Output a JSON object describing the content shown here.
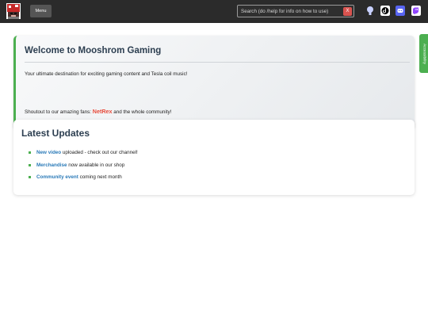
{
  "header": {
    "menu_label": "Menu",
    "search": {
      "placeholder": "Search (do /help for info on how to use)",
      "clear_label": "X"
    },
    "social_icons": [
      "github-icon",
      "tiktok-icon",
      "discord-icon",
      "twitch-icon"
    ]
  },
  "accessibility_tab": "Accessibility",
  "welcome": {
    "title": "Welcome to Mooshrom Gaming",
    "intro": "Your ultimate destination for exciting gaming content and Tesla coil music!",
    "shoutout_before": "Shoutout to our amazing fans: ",
    "shoutout_name": "NetRex",
    "shoutout_after": " and the whole community!"
  },
  "updates": {
    "title": "Latest Updates",
    "items": [
      {
        "link": "New video",
        "text": " uploaded - check out our channel!"
      },
      {
        "link": "Merchandise",
        "text": " now available in our shop"
      },
      {
        "link": "Community event",
        "text": " coming next month"
      }
    ]
  },
  "colors": {
    "accent": "#4caf50",
    "link": "#2a7ab8",
    "fan_name": "#e74c3c",
    "topbar": "#2b2b2b"
  }
}
